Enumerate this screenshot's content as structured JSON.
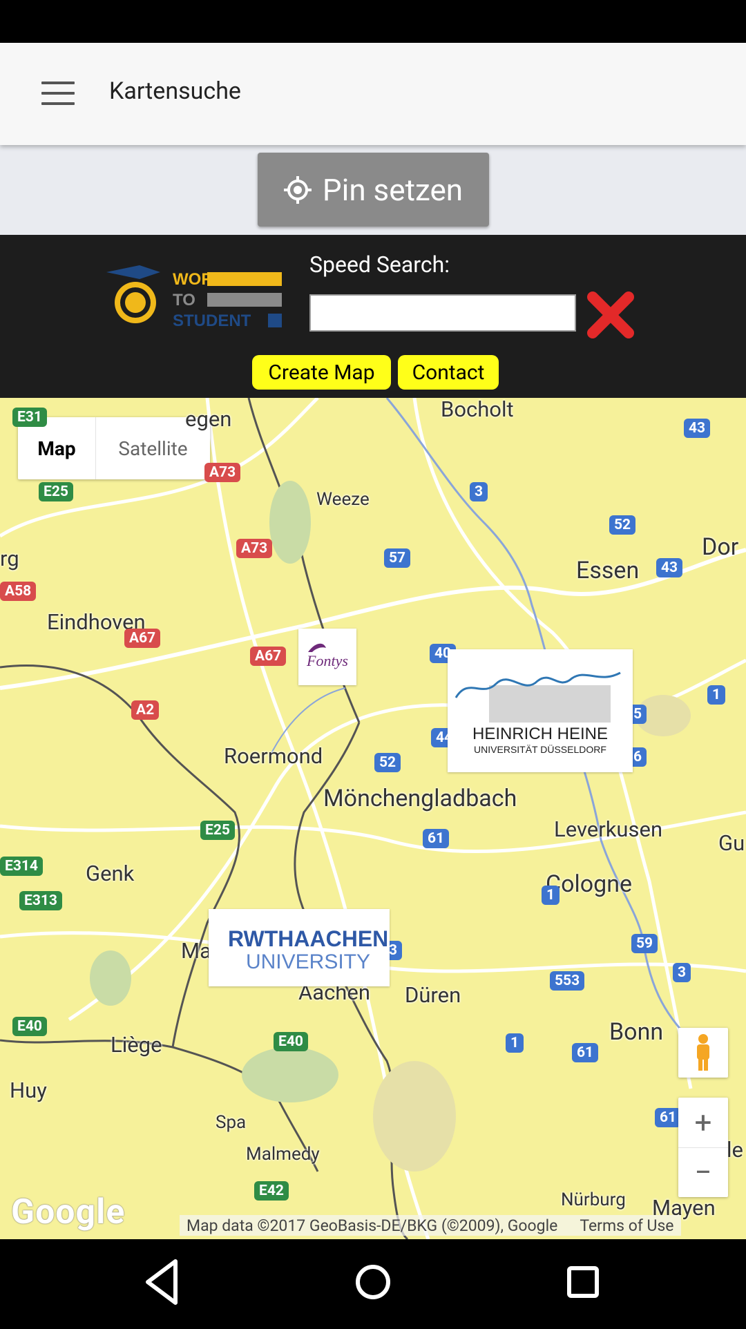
{
  "app_bar": {
    "title": "Kartensuche",
    "menu_icon": "hamburger-menu-icon"
  },
  "pin": {
    "label": "Pin setzen",
    "icon": "crosshair-icon"
  },
  "speed_search": {
    "logo_lines": [
      "WORK",
      "TO",
      "STUDENT"
    ],
    "label": "Speed Search:",
    "value": "",
    "clear_icon": "red-x-icon",
    "create_map": "Create Map",
    "contact": "Contact"
  },
  "map": {
    "type_controls": {
      "map": "Map",
      "satellite": "Satellite",
      "selected": "Map"
    },
    "places": [
      "Bocholt",
      "egen",
      "Weeze",
      "Essen",
      "Dor",
      "rg",
      "Eindhoven",
      "Roermond",
      "Mönchengladbach",
      "Leverkusen",
      "Gu",
      "Cologne",
      "Genk",
      "Ma",
      "Aachen",
      "Düren",
      "Bonn",
      "Liège",
      "Huy",
      "Spa",
      "Malmedy",
      "Nürburg",
      "Mayen",
      "le"
    ],
    "road_labels": [
      "E31",
      "A73",
      "E25",
      "3",
      "43",
      "52",
      "A73",
      "57",
      "43",
      "A58",
      "A67",
      "40",
      "A67",
      "1",
      "A2",
      "44",
      "5",
      "6",
      "52",
      "E25",
      "61",
      "E314",
      "E313",
      "1",
      "3",
      "59",
      "553",
      "3",
      "E40",
      "1",
      "61",
      "E40",
      "61",
      "E42"
    ],
    "logos": {
      "fontys": "Fontys",
      "hhu_line1": "HEINRICH HEINE",
      "hhu_line2": "UNIVERSITÄT DÜSSELDORF",
      "rwth_line1": "RWTHAACHEN",
      "rwth_line2": "UNIVERSITY"
    },
    "zoom_in": "+",
    "zoom_out": "−",
    "google": "Google",
    "attribution": "Map data ©2017 GeoBasis-DE/BKG (©2009), Google",
    "terms": "Terms of Use"
  },
  "colors": {
    "map_land": "#f6f19a",
    "yellow_button": "#ffff19",
    "pin_button": "#8a8a8a",
    "road_blue": "#3d74cf",
    "road_red": "#d84c4c"
  }
}
